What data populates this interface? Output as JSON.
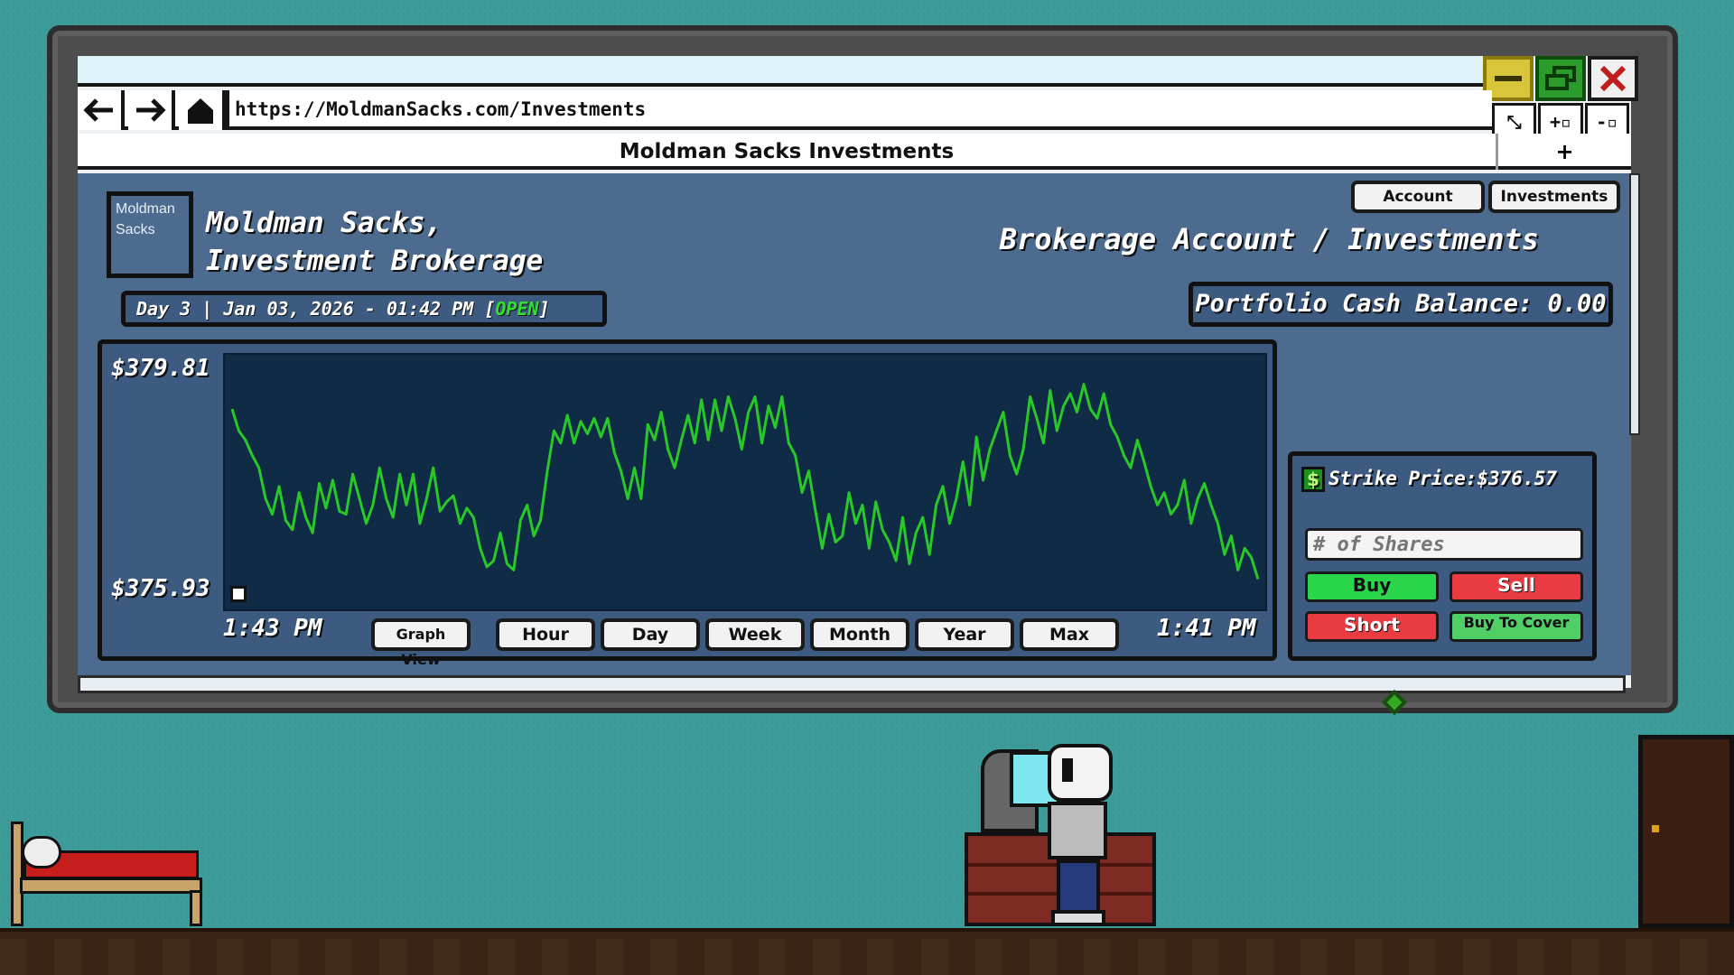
{
  "browser": {
    "url": "https://MoldmanSacks.com/Investments",
    "tab_title": "Moldman Sacks Investments",
    "new_tab": "+",
    "nav": {
      "back": "←",
      "forward": "→",
      "home": "⌂"
    },
    "window_buttons": {
      "minimize": "—",
      "maximize": "▭",
      "close": "✕"
    },
    "tools": [
      "⤡",
      "+▫",
      "-▫"
    ]
  },
  "page": {
    "logo_text": "Moldman Sacks",
    "brand_line1": "Moldman Sacks,",
    "brand_line2": "Investment Brokerage",
    "date_text": "Day 3 | Jan 03, 2026 - 01:42 PM [",
    "market_status": "OPEN",
    "date_close": "]",
    "nav_buttons": {
      "account": "Account",
      "investments": "Investments"
    },
    "subtitle": "Brokerage Account / Investments",
    "cash_balance": "Portfolio Cash Balance: 0.00"
  },
  "chart": {
    "y_max_label": "$379.81",
    "y_min_label": "$375.93",
    "x_left_label": "1:43 PM",
    "x_right_label": "1:41 PM",
    "graph_view": "Graph View",
    "ranges": [
      "Hour",
      "Day",
      "Week",
      "Month",
      "Year",
      "Max"
    ]
  },
  "chart_data": {
    "type": "line",
    "ylim": [
      375.93,
      379.81
    ],
    "line_color": "#29c829",
    "series": [
      {
        "values": [
          379.05,
          378.7,
          378.55,
          378.3,
          378.1,
          377.6,
          377.35,
          377.8,
          377.25,
          377.1,
          377.7,
          377.3,
          377.05,
          377.85,
          377.45,
          377.9,
          377.4,
          377.35,
          378.0,
          377.6,
          377.2,
          377.5,
          378.1,
          377.6,
          377.3,
          378.0,
          377.5,
          378.0,
          377.2,
          377.6,
          378.1,
          377.4,
          377.55,
          377.65,
          377.2,
          377.45,
          377.3,
          376.8,
          376.5,
          376.6,
          377.05,
          376.55,
          376.45,
          377.25,
          377.5,
          377.0,
          377.25,
          378.05,
          378.7,
          378.5,
          378.95,
          378.5,
          378.85,
          378.65,
          378.9,
          378.6,
          378.9,
          378.35,
          378.05,
          377.6,
          378.1,
          377.6,
          378.8,
          378.55,
          379.0,
          378.4,
          378.1,
          378.55,
          378.95,
          378.5,
          379.2,
          378.55,
          379.2,
          378.7,
          379.25,
          378.9,
          378.4,
          379.0,
          379.25,
          378.5,
          379.1,
          378.75,
          379.25,
          378.5,
          378.3,
          377.7,
          378.05,
          377.4,
          376.8,
          377.35,
          376.9,
          377.0,
          377.7,
          377.2,
          377.5,
          376.8,
          377.55,
          377.1,
          376.9,
          376.6,
          377.3,
          376.55,
          377.05,
          377.3,
          376.7,
          377.5,
          377.8,
          377.2,
          377.6,
          378.2,
          377.5,
          378.6,
          377.9,
          378.4,
          378.7,
          379.0,
          378.3,
          378.0,
          378.4,
          379.25,
          378.9,
          378.5,
          379.35,
          378.7,
          379.1,
          379.3,
          379.0,
          379.45,
          379.05,
          378.9,
          379.3,
          378.8,
          378.6,
          378.3,
          378.1,
          378.55,
          378.2,
          377.8,
          377.5,
          377.7,
          377.35,
          377.5,
          377.9,
          377.2,
          377.6,
          377.85,
          377.5,
          377.2,
          376.7,
          377.0,
          376.45,
          376.8,
          376.65,
          376.3
        ]
      }
    ]
  },
  "trade": {
    "dollar_icon": "$",
    "strike_label": "Strike Price:",
    "strike_value": "$376.57",
    "shares_placeholder": "# of Shares",
    "buy": "Buy",
    "sell": "Sell",
    "short": "Short",
    "buy_to_cover": "Buy To Cover"
  }
}
